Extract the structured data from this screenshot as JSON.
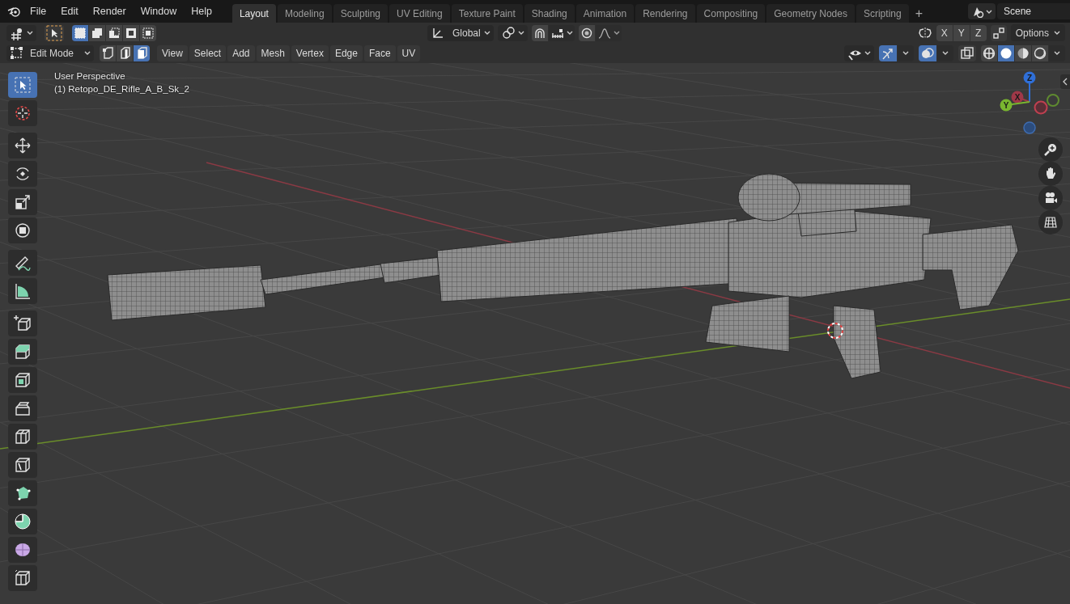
{
  "top_bar": {
    "menu": [
      "File",
      "Edit",
      "Render",
      "Window",
      "Help"
    ],
    "workspaces": [
      {
        "label": "Layout",
        "selected": true
      },
      {
        "label": "Modeling",
        "selected": false
      },
      {
        "label": "Sculpting",
        "selected": false
      },
      {
        "label": "UV Editing",
        "selected": false
      },
      {
        "label": "Texture Paint",
        "selected": false
      },
      {
        "label": "Shading",
        "selected": false
      },
      {
        "label": "Animation",
        "selected": false
      },
      {
        "label": "Rendering",
        "selected": false
      },
      {
        "label": "Compositing",
        "selected": false
      },
      {
        "label": "Geometry Nodes",
        "selected": false
      },
      {
        "label": "Scripting",
        "selected": false
      }
    ],
    "add_workspace": "+",
    "scene": "Scene"
  },
  "tool_header": {
    "select_box_modes": [
      {
        "kind": "set",
        "selected": true
      },
      {
        "kind": "extend",
        "selected": false
      },
      {
        "kind": "subtract",
        "selected": false
      },
      {
        "kind": "invert",
        "selected": false
      },
      {
        "kind": "intersect",
        "selected": false
      }
    ],
    "orientation": "Global",
    "mirror_axes": [
      {
        "label": "X",
        "selected": false
      },
      {
        "label": "Y",
        "selected": false
      },
      {
        "label": "Z",
        "selected": false
      }
    ],
    "options": "Options"
  },
  "header": {
    "mode": "Edit Mode",
    "select_modes": [
      {
        "kind": "vertex",
        "selected": false
      },
      {
        "kind": "edge",
        "selected": false
      },
      {
        "kind": "face",
        "selected": true
      }
    ],
    "menus": [
      "View",
      "Select",
      "Add",
      "Mesh",
      "Vertex",
      "Edge",
      "Face",
      "UV"
    ],
    "gizmos_on": true,
    "overlays_on": true,
    "xray_on": false,
    "shading": [
      {
        "kind": "wireframe",
        "selected": false
      },
      {
        "kind": "solid",
        "selected": true
      },
      {
        "kind": "material",
        "selected": false
      },
      {
        "kind": "rendered",
        "selected": false
      }
    ]
  },
  "toolbar": [
    {
      "tools": [
        {
          "kind": "select",
          "selected": true
        },
        {
          "kind": "cursor",
          "selected": false
        }
      ]
    },
    {
      "tools": [
        {
          "kind": "move",
          "selected": false
        },
        {
          "kind": "rotate",
          "selected": false
        },
        {
          "kind": "scale",
          "selected": false
        },
        {
          "kind": "transform",
          "selected": false
        }
      ]
    },
    {
      "tools": [
        {
          "kind": "annotate",
          "selected": false
        },
        {
          "kind": "measure",
          "selected": false
        }
      ]
    },
    {
      "tools": [
        {
          "kind": "add_cube",
          "selected": false
        },
        {
          "kind": "extrude",
          "selected": false
        },
        {
          "kind": "inset",
          "selected": false
        },
        {
          "kind": "bevel",
          "selected": false
        },
        {
          "kind": "loop_cut",
          "selected": false
        },
        {
          "kind": "knife",
          "selected": false
        },
        {
          "kind": "poly_build",
          "selected": false
        },
        {
          "kind": "spin",
          "selected": false
        },
        {
          "kind": "smooth",
          "selected": false
        },
        {
          "kind": "shear",
          "selected": false
        }
      ]
    }
  ],
  "viewport": {
    "view_name": "User Perspective",
    "object_name": "(1) Retopo_DE_Rifle_A_B_Sk_2",
    "gizmo_axes": [
      {
        "label": "Z"
      },
      {
        "label": "X"
      },
      {
        "label": "Y"
      }
    ]
  }
}
